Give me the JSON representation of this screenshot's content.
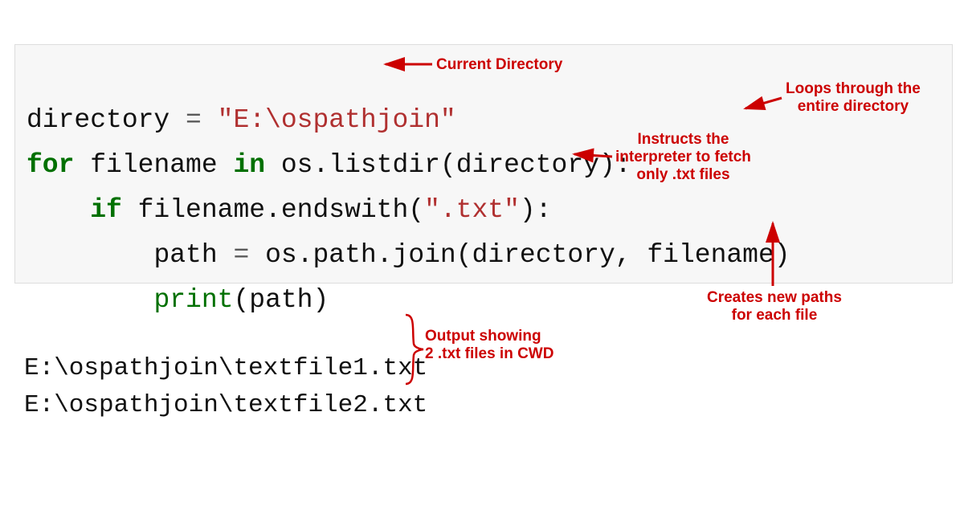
{
  "code": {
    "l1": {
      "var": "directory",
      "eq": " = ",
      "str": "\"E:\\ospathjoin\""
    },
    "l2": {
      "kw_for": "for",
      "s1": " filename ",
      "kw_in": "in",
      "s2": " os.listdir(directory):"
    },
    "l3": {
      "indent": "    ",
      "kw_if": "if",
      "s1": " filename.endswith(",
      "str": "\".txt\"",
      "s2": "):"
    },
    "l4": {
      "indent": "        ",
      "s1": "path ",
      "eq": "=",
      "s2": " os.path.join(directory, filename)"
    },
    "l5": {
      "indent": "        ",
      "builtin": "print",
      "s1": "(path)"
    }
  },
  "output": {
    "l1": "E:\\ospathjoin\\textfile1.txt",
    "l2": "E:\\ospathjoin\\textfile2.txt"
  },
  "annotations": {
    "current_dir": "Current Directory",
    "loops": "Loops through the\nentire directory",
    "instructs": "Instructs the\ninterpreter to fetch\nonly .txt files",
    "creates": "Creates new paths\nfor each file",
    "output_note": "Output showing\n2 .txt files in CWD"
  },
  "colors": {
    "annotation": "#cc0000",
    "code_bg": "#f7f7f7",
    "keyword": "#007000",
    "string": "#b03030"
  }
}
